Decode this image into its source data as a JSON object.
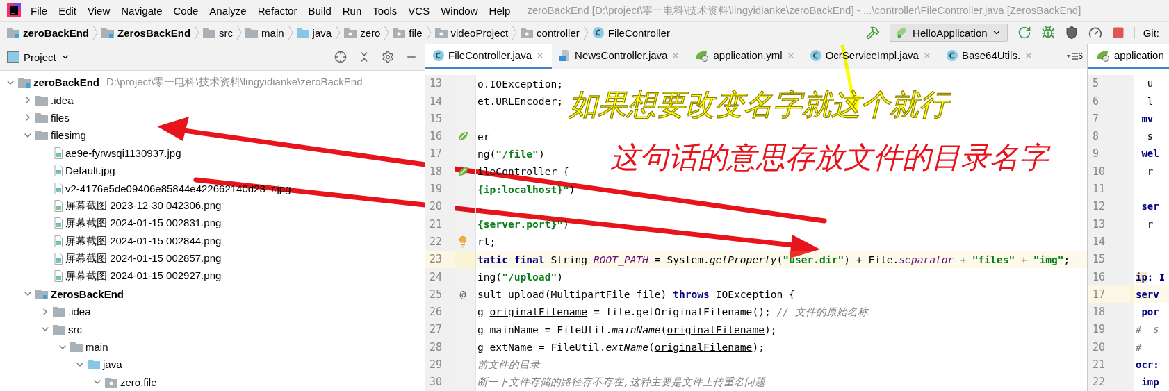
{
  "menu": [
    "File",
    "Edit",
    "View",
    "Navigate",
    "Code",
    "Analyze",
    "Refactor",
    "Build",
    "Run",
    "Tools",
    "VCS",
    "Window",
    "Help"
  ],
  "window_title": "zeroBackEnd [D:\\project\\零一电科\\技术资料\\lingyidianke\\zeroBackEnd] - ...\\controller\\FileController.java [ZerosBackEnd]",
  "breadcrumbs": [
    {
      "label": "zeroBackEnd",
      "kind": "module"
    },
    {
      "label": "ZerosBackEnd",
      "kind": "module"
    },
    {
      "label": "src",
      "kind": "folder"
    },
    {
      "label": "main",
      "kind": "folder"
    },
    {
      "label": "java",
      "kind": "source"
    },
    {
      "label": "zero",
      "kind": "package"
    },
    {
      "label": "file",
      "kind": "package"
    },
    {
      "label": "videoProject",
      "kind": "package"
    },
    {
      "label": "controller",
      "kind": "package"
    },
    {
      "label": "FileController",
      "kind": "class"
    }
  ],
  "run_config": "HelloApplication",
  "vcs_label": "Git:",
  "project_panel": {
    "title": "Project",
    "tree": [
      {
        "label": "zeroBackEnd",
        "note": "D:\\project\\零一电科\\技术资料\\lingyidianke\\zeroBackEnd",
        "kind": "module",
        "expanded": true,
        "children": [
          {
            "label": ".idea",
            "kind": "folder",
            "expanded": false
          },
          {
            "label": "files",
            "kind": "folder",
            "expanded": false
          },
          {
            "label": "filesimg",
            "kind": "folder",
            "expanded": true,
            "children": [
              {
                "label": "ae9e-fyrwsqi1130937.jpg",
                "kind": "image"
              },
              {
                "label": "Default.jpg",
                "kind": "image"
              },
              {
                "label": "v2-4176e5de09406e85844e422662140d23_r.jpg",
                "kind": "image"
              },
              {
                "label": "屏幕截图 2023-12-30 042306.png",
                "kind": "image"
              },
              {
                "label": "屏幕截图 2024-01-15 002831.png",
                "kind": "image"
              },
              {
                "label": "屏幕截图 2024-01-15 002844.png",
                "kind": "image"
              },
              {
                "label": "屏幕截图 2024-01-15 002857.png",
                "kind": "image"
              },
              {
                "label": "屏幕截图 2024-01-15 002927.png",
                "kind": "image"
              }
            ]
          },
          {
            "label": "ZerosBackEnd",
            "kind": "module",
            "expanded": true,
            "children": [
              {
                "label": ".idea",
                "kind": "folder",
                "expanded": false
              },
              {
                "label": "src",
                "kind": "folder",
                "expanded": true,
                "children": [
                  {
                    "label": "main",
                    "kind": "folder",
                    "expanded": true,
                    "children": [
                      {
                        "label": "java",
                        "kind": "source",
                        "expanded": true,
                        "children": [
                          {
                            "label": "zero.file",
                            "kind": "package",
                            "expanded": true
                          }
                        ]
                      }
                    ]
                  }
                ]
              }
            ]
          }
        ]
      }
    ]
  },
  "editor": {
    "tabs": [
      {
        "label": "FileController.java",
        "kind": "class",
        "selected": true
      },
      {
        "label": "NewsController.java",
        "kind": "java",
        "selected": false
      },
      {
        "label": "application.yml",
        "kind": "yaml",
        "selected": false
      },
      {
        "label": "OcrServiceImpl.java",
        "kind": "class",
        "selected": false
      },
      {
        "label": "Base64Utils.",
        "kind": "class",
        "selected": false
      }
    ],
    "tabs_overflow": "6",
    "lines": [
      {
        "number": "13",
        "current": false,
        "segments": [
          {
            "text": "o.IOException;",
            "kind": "plain"
          }
        ]
      },
      {
        "number": "14",
        "current": false,
        "segments": [
          {
            "text": "et.URLEncoder;",
            "kind": "plain"
          }
        ]
      },
      {
        "number": "15",
        "current": false
      },
      {
        "number": "16",
        "current": false,
        "gutter": {
          "kind": "bean"
        },
        "segments": [
          {
            "text": "er",
            "kind": "plain"
          }
        ]
      },
      {
        "number": "17",
        "current": false,
        "segments": [
          {
            "text": "ng(",
            "kind": "plain"
          },
          {
            "text": "\"/file\"",
            "kind": "string"
          },
          {
            "text": ")",
            "kind": "plain"
          }
        ]
      },
      {
        "number": "18",
        "current": false,
        "gutter": {
          "kind": "bean"
        },
        "segments": [
          {
            "text": "ileController {",
            "kind": "plain"
          }
        ]
      },
      {
        "number": "19",
        "current": false,
        "segments": [
          {
            "text": "{ip:localhost}\"",
            "kind": "string"
          },
          {
            "text": ")",
            "kind": "plain"
          }
        ]
      },
      {
        "number": "20",
        "current": false,
        "segments": [
          {
            "text": ".",
            "kind": "plain"
          }
        ]
      },
      {
        "number": "21",
        "current": false,
        "segments": [
          {
            "text": "{server.port}\"",
            "kind": "string"
          },
          {
            "text": ")",
            "kind": "plain"
          }
        ]
      },
      {
        "number": "22",
        "current": false,
        "gutter": {
          "kind": "bulb"
        },
        "segments": [
          {
            "text": "rt;",
            "kind": "plain"
          }
        ]
      },
      {
        "number": "23",
        "current": true,
        "segments": [
          {
            "text": "tatic final",
            "kind": "keyword"
          },
          {
            "text": " String ",
            "kind": "plain"
          },
          {
            "text": "ROOT_PATH",
            "kind": "constant"
          },
          {
            "text": " = System.",
            "kind": "plain"
          },
          {
            "text": "getProperty",
            "kind": "method"
          },
          {
            "text": "(",
            "kind": "plain"
          },
          {
            "text": "\"user.dir\"",
            "kind": "string"
          },
          {
            "text": ") + File.",
            "kind": "plain"
          },
          {
            "text": "separator",
            "kind": "constant"
          },
          {
            "text": " + ",
            "kind": "plain"
          },
          {
            "text": "\"files\"",
            "kind": "string"
          },
          {
            "text": " + ",
            "kind": "plain"
          },
          {
            "text": "\"img\"",
            "kind": "string"
          },
          {
            "text": ";",
            "kind": "plain"
          }
        ]
      },
      {
        "number": "24",
        "current": false,
        "segments": [
          {
            "text": "ing(",
            "kind": "plain"
          },
          {
            "text": "\"/upload\"",
            "kind": "string"
          },
          {
            "text": ")",
            "kind": "plain"
          }
        ]
      },
      {
        "number": "25",
        "current": false,
        "gutter": {
          "kind": "text",
          "text": "@"
        },
        "segments": [
          {
            "text": "sult upload(MultipartFile file) ",
            "kind": "plain"
          },
          {
            "text": "throws",
            "kind": "keyword"
          },
          {
            "text": " IOException {",
            "kind": "plain"
          }
        ]
      },
      {
        "number": "26",
        "current": false,
        "segments": [
          {
            "text": "g ",
            "kind": "plain"
          },
          {
            "text": "originalFilename",
            "kind": "underline"
          },
          {
            "text": " = file.getOriginalFilename(); ",
            "kind": "plain"
          },
          {
            "text": "// 文件的原始名称",
            "kind": "comment"
          }
        ]
      },
      {
        "number": "27",
        "current": false,
        "segments": [
          {
            "text": "g mainName = FileUtil.",
            "kind": "plain"
          },
          {
            "text": "mainName",
            "kind": "method"
          },
          {
            "text": "(",
            "kind": "plain"
          },
          {
            "text": "originalFilename",
            "kind": "underline"
          },
          {
            "text": ");",
            "kind": "plain"
          }
        ]
      },
      {
        "number": "28",
        "current": false,
        "segments": [
          {
            "text": "g extName = FileUtil.",
            "kind": "plain"
          },
          {
            "text": "extName",
            "kind": "method"
          },
          {
            "text": "(",
            "kind": "plain"
          },
          {
            "text": "originalFilename",
            "kind": "underline"
          },
          {
            "text": ");",
            "kind": "plain"
          }
        ]
      },
      {
        "number": "29",
        "current": false,
        "segments": [
          {
            "text": "前文件的目录",
            "kind": "comment"
          }
        ]
      },
      {
        "number": "30",
        "current": false,
        "segments": [
          {
            "text": "断一下文件存储的路径存不存在,这种主要是文件上传重名问题",
            "kind": "comment"
          }
        ]
      }
    ]
  },
  "side_editor": {
    "tab": "application",
    "lines": [
      {
        "number": "5",
        "current": false,
        "segments": [
          {
            "text": "  u",
            "kind": "plain"
          }
        ]
      },
      {
        "number": "6",
        "current": false,
        "segments": [
          {
            "text": "  l",
            "kind": "plain"
          }
        ]
      },
      {
        "number": "7",
        "current": false,
        "segments": [
          {
            "text": " mv",
            "kind": "keyword"
          }
        ]
      },
      {
        "number": "8",
        "current": false,
        "segments": [
          {
            "text": "  s",
            "kind": "plain"
          }
        ]
      },
      {
        "number": "9",
        "current": false,
        "segments": [
          {
            "text": " wel",
            "kind": "keyword"
          }
        ]
      },
      {
        "number": "10",
        "current": false,
        "segments": [
          {
            "text": "  r",
            "kind": "plain"
          }
        ]
      },
      {
        "number": "11",
        "current": false
      },
      {
        "number": "12",
        "current": false,
        "segments": [
          {
            "text": " ser",
            "kind": "keyword"
          }
        ]
      },
      {
        "number": "13",
        "current": false,
        "segments": [
          {
            "text": "  r",
            "kind": "plain"
          }
        ]
      },
      {
        "number": "14",
        "current": false
      },
      {
        "number": "15",
        "current": false
      },
      {
        "number": "16",
        "current": false,
        "segments": [
          {
            "text": "ip",
            "kind": "highlight"
          },
          {
            "text": ": I",
            "kind": "keyword"
          }
        ]
      },
      {
        "number": "17",
        "current": true,
        "segments": [
          {
            "text": "serv",
            "kind": "keyword"
          }
        ]
      },
      {
        "number": "18",
        "current": false,
        "segments": [
          {
            "text": " por",
            "kind": "keyword"
          }
        ]
      },
      {
        "number": "19",
        "current": false,
        "segments": [
          {
            "text": "#  s",
            "kind": "comment"
          }
        ]
      },
      {
        "number": "20",
        "current": false,
        "segments": [
          {
            "text": "#",
            "kind": "comment"
          }
        ]
      },
      {
        "number": "21",
        "current": false,
        "segments": [
          {
            "text": "ocr:",
            "kind": "keyword"
          }
        ]
      },
      {
        "number": "22",
        "current": false,
        "segments": [
          {
            "text": " imp",
            "kind": "keyword"
          }
        ]
      }
    ]
  },
  "annotations": [
    {
      "text": "如果想要改变名字就这个就行",
      "color": "#ffff00"
    },
    {
      "text": "这句话的意思存放文件的目录名字",
      "color": "#e8141b"
    }
  ]
}
